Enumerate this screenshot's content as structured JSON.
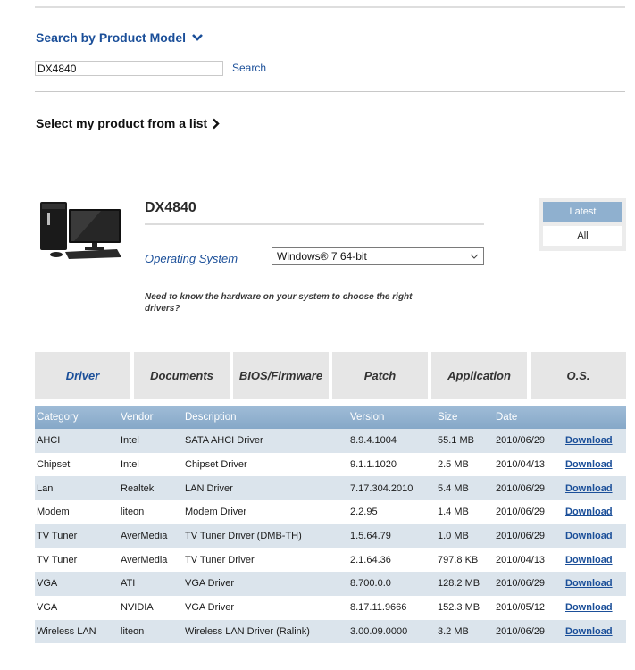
{
  "search": {
    "heading": "Search by Product Model",
    "input_value": "DX4840",
    "button_label": "Search"
  },
  "select_list_label": "Select my product from a list",
  "product": {
    "model": "DX4840",
    "os_label": "Operating System",
    "os_selected": "Windows® 7 64-bit",
    "hardware_note": "Need to know the hardware on your system to choose the right drivers?"
  },
  "filter": {
    "latest_label": "Latest",
    "all_label": "All"
  },
  "tabs": [
    {
      "label": "Driver",
      "active": true
    },
    {
      "label": "Documents"
    },
    {
      "label": "BIOS/Firmware"
    },
    {
      "label": "Patch"
    },
    {
      "label": "Application"
    },
    {
      "label": "O.S."
    }
  ],
  "table": {
    "headers": [
      "Category",
      "Vendor",
      "Description",
      "Version",
      "Size",
      "Date",
      ""
    ],
    "rows": [
      {
        "category": "AHCI",
        "vendor": "Intel",
        "description": "SATA AHCI Driver",
        "version": "8.9.4.1004",
        "size": "55.1 MB",
        "date": "2010/06/29",
        "link": "Download"
      },
      {
        "category": "Chipset",
        "vendor": "Intel",
        "description": "Chipset Driver",
        "version": "9.1.1.1020",
        "size": "2.5 MB",
        "date": "2010/04/13",
        "link": "Download"
      },
      {
        "category": "Lan",
        "vendor": "Realtek",
        "description": "LAN Driver",
        "version": "7.17.304.2010",
        "size": "5.4 MB",
        "date": "2010/06/29",
        "link": "Download"
      },
      {
        "category": "Modem",
        "vendor": "liteon",
        "description": "Modem Driver",
        "version": "2.2.95",
        "size": "1.4 MB",
        "date": "2010/06/29",
        "link": "Download"
      },
      {
        "category": "TV Tuner",
        "vendor": "AverMedia",
        "description": "TV Tuner Driver (DMB-TH)",
        "version": "1.5.64.79",
        "size": "1.0 MB",
        "date": "2010/06/29",
        "link": "Download"
      },
      {
        "category": "TV Tuner",
        "vendor": "AverMedia",
        "description": "TV Tuner Driver",
        "version": "2.1.64.36",
        "size": "797.8 KB",
        "date": "2010/04/13",
        "link": "Download"
      },
      {
        "category": "VGA",
        "vendor": "ATI",
        "description": "VGA Driver",
        "version": "8.700.0.0",
        "size": "128.2 MB",
        "date": "2010/06/29",
        "link": "Download"
      },
      {
        "category": "VGA",
        "vendor": "NVIDIA",
        "description": "VGA Driver",
        "version": "8.17.11.9666",
        "size": "152.3 MB",
        "date": "2010/05/12",
        "link": "Download"
      },
      {
        "category": "Wireless LAN",
        "vendor": "liteon",
        "description": "Wireless LAN Driver (Ralink)",
        "version": "3.00.09.0000",
        "size": "3.2 MB",
        "date": "2010/06/29",
        "link": "Download"
      }
    ]
  },
  "colors": {
    "brand_blue": "#1b4f99",
    "header_blue": "#8fb0cf",
    "row_stripe": "#dbe4ec"
  }
}
